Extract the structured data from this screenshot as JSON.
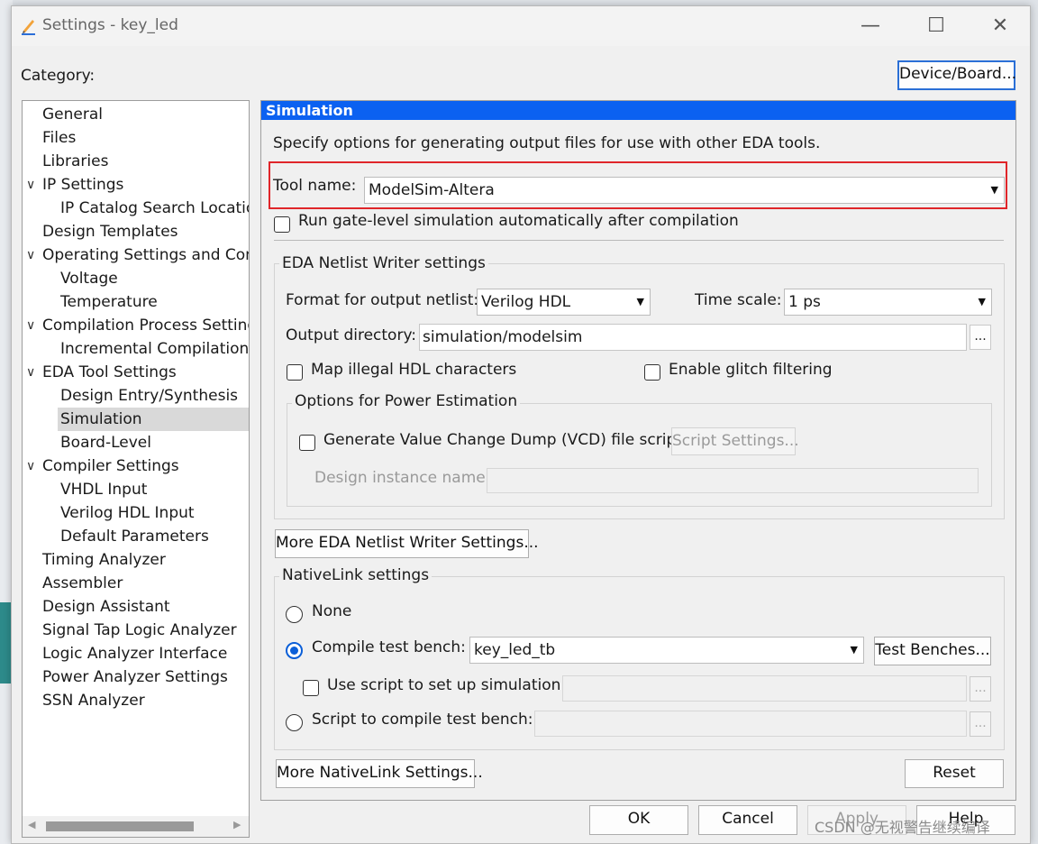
{
  "window": {
    "title": "Settings - key_led",
    "minimize": "—",
    "maximize": "☐",
    "close": "✕"
  },
  "category_label": "Category:",
  "device_board_button": "Device/Board...",
  "category_tree": [
    {
      "label": "General",
      "level": 0
    },
    {
      "label": "Files",
      "level": 0
    },
    {
      "label": "Libraries",
      "level": 0
    },
    {
      "label": "IP Settings",
      "level": 0,
      "expanded": true
    },
    {
      "label": "IP Catalog Search Location",
      "level": 1
    },
    {
      "label": "Design Templates",
      "level": 0
    },
    {
      "label": "Operating Settings and Conditions",
      "level": 0,
      "expanded": true
    },
    {
      "label": "Voltage",
      "level": 1
    },
    {
      "label": "Temperature",
      "level": 1
    },
    {
      "label": "Compilation Process Settings",
      "level": 0,
      "expanded": true
    },
    {
      "label": "Incremental Compilation",
      "level": 1
    },
    {
      "label": "EDA Tool Settings",
      "level": 0,
      "expanded": true
    },
    {
      "label": "Design Entry/Synthesis",
      "level": 1
    },
    {
      "label": "Simulation",
      "level": 1,
      "selected": true
    },
    {
      "label": "Board-Level",
      "level": 1
    },
    {
      "label": "Compiler Settings",
      "level": 0,
      "expanded": true
    },
    {
      "label": "VHDL Input",
      "level": 1
    },
    {
      "label": "Verilog HDL Input",
      "level": 1
    },
    {
      "label": "Default Parameters",
      "level": 1
    },
    {
      "label": "Timing Analyzer",
      "level": 0
    },
    {
      "label": "Assembler",
      "level": 0
    },
    {
      "label": "Design Assistant",
      "level": 0
    },
    {
      "label": "Signal Tap Logic Analyzer",
      "level": 0
    },
    {
      "label": "Logic Analyzer Interface",
      "level": 0
    },
    {
      "label": "Power Analyzer Settings",
      "level": 0
    },
    {
      "label": "SSN Analyzer",
      "level": 0
    }
  ],
  "simulation": {
    "header": "Simulation",
    "description": "Specify options for generating output files for use with other EDA tools.",
    "tool_name_label": "Tool name:",
    "tool_name_value": "ModelSim-Altera",
    "run_gate_level_label": "Run gate-level simulation automatically after compilation",
    "run_gate_level_checked": false
  },
  "netlist": {
    "group_title": "EDA Netlist Writer settings",
    "format_label": "Format for output netlist:",
    "format_value": "Verilog HDL",
    "time_scale_label": "Time scale:",
    "time_scale_value": "1 ps",
    "output_dir_label": "Output directory:",
    "output_dir_value": "simulation/modelsim",
    "browse": "...",
    "map_illegal_label": "Map illegal HDL characters",
    "map_illegal_checked": false,
    "glitch_label": "Enable glitch filtering",
    "glitch_checked": false,
    "power_group_title": "Options for Power Estimation",
    "vcd_label": "Generate Value Change Dump (VCD) file script",
    "vcd_checked": false,
    "script_settings_button": "Script Settings...",
    "design_instance_label": "Design instance name:",
    "design_instance_value": "",
    "more_button": "More EDA Netlist Writer Settings..."
  },
  "nativelink": {
    "group_title": "NativeLink settings",
    "none_label": "None",
    "compile_tb_label": "Compile test bench:",
    "compile_tb_value": "key_led_tb",
    "test_benches_button": "Test Benches...",
    "use_script_label": "Use script to set up simulation:",
    "use_script_value": "",
    "script_compile_label": "Script to compile test bench:",
    "script_compile_value": "",
    "selected_option": "Compile test bench:",
    "browse": "...",
    "more_button": "More NativeLink Settings...",
    "reset_button": "Reset"
  },
  "footer": {
    "ok": "OK",
    "cancel": "Cancel",
    "apply": "Apply",
    "help": "Help"
  },
  "watermark": "CSDN @无视警告继续编译",
  "colors": {
    "header_blue": "#0b61f1",
    "highlight_red": "#e0262a",
    "radio_blue": "#0b5fd8"
  }
}
